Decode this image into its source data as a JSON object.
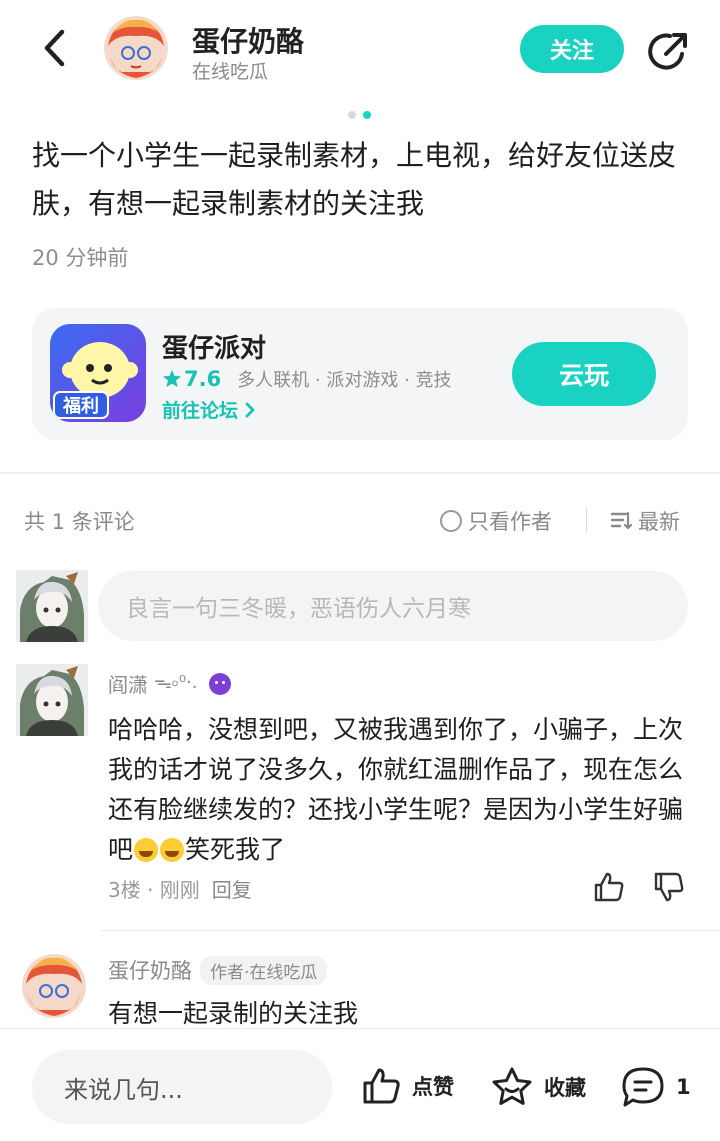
{
  "header": {
    "author_name": "蛋仔奶酪",
    "author_status": "在线吃瓜",
    "follow_label": "关注",
    "back_icon": "chevron-left-icon",
    "share_icon": "share-icon"
  },
  "pager": {
    "total": 2,
    "active": 2
  },
  "post": {
    "text": "找一个小学生一起录制素材，上电视，给好友位送皮肤，有想一起录制素材的关注我",
    "time": "20 分钟前"
  },
  "game": {
    "name": "蛋仔派对",
    "rating": "7.6",
    "tags": "多人联机 · 派对游戏 · 竞技",
    "forum_link": "前往论坛",
    "play_label": "云玩",
    "icon_badge": "福利"
  },
  "comments_bar": {
    "count_label": "共 1 条评论",
    "only_author_label": "只看作者",
    "sort_label": "最新"
  },
  "comment_input": {
    "placeholder": "良言一句三冬暖，恶语伤人六月寒"
  },
  "comment": {
    "user_name": "阎潇",
    "user_decoration": "ᯓ৹⁰·.",
    "text_main": "哈哈哈，没想到吧，又被我遇到你了，小骗子，上次我的话才说了没多久，你就红温删作品了，现在怎么还有脸继续发的？还找小学生呢？是因为小学生好骗吧",
    "text_tail": "笑死我了",
    "floor": "3楼 · 刚刚",
    "reply_label": "回复"
  },
  "reply": {
    "user_name": "蛋仔奶酪",
    "badge": "作者·在线吃瓜",
    "text": "有想一起录制的关注我"
  },
  "bottom_bar": {
    "input_placeholder": "来说几句...",
    "like_label": "点赞",
    "fav_label": "收藏",
    "comment_count": "1"
  },
  "colors": {
    "accent": "#19d2c1",
    "text_primary": "#1f1f1f",
    "text_secondary": "#8a8a8a"
  }
}
